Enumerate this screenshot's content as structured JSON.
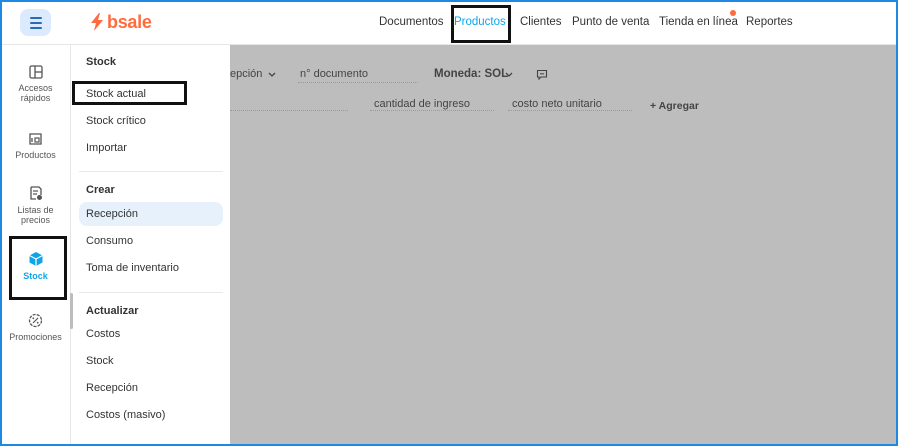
{
  "brand": {
    "name": "bsale",
    "color": "#ff6b3d",
    "accent": "#0ea5e9"
  },
  "topnav": [
    {
      "label": "Documentos",
      "active": false
    },
    {
      "label": "Productos",
      "active": true
    },
    {
      "label": "Clientes",
      "active": false
    },
    {
      "label": "Punto de venta",
      "active": false
    },
    {
      "label": "Tienda en línea",
      "active": false,
      "badge": true
    },
    {
      "label": "Reportes",
      "active": false
    }
  ],
  "rail": [
    {
      "label": "Accesos rápidos",
      "icon": "quick-access-icon"
    },
    {
      "label": "Productos",
      "icon": "products-icon"
    },
    {
      "label": "Listas de precios",
      "icon": "price-list-icon"
    },
    {
      "label": "Stock",
      "icon": "stock-box-icon",
      "active": true
    },
    {
      "label": "Promociones",
      "icon": "promotions-icon"
    }
  ],
  "panel": {
    "stock_title": "Stock",
    "stock_items": [
      "Stock actual",
      "Stock crítico",
      "Importar"
    ],
    "crear_title": "Crear",
    "crear_items": [
      "Recepción",
      "Consumo",
      "Toma de inventario"
    ],
    "actualizar_title": "Actualizar",
    "actualizar_items": [
      "Costos",
      "Stock",
      "Recepción",
      "Costos (masivo)"
    ]
  },
  "background_form": {
    "type_partial": "epción",
    "document_number_placeholder": "n° documento",
    "currency": "Moneda: SOL",
    "col_qty": "cantidad de ingreso",
    "col_cost": "costo neto unitario",
    "add_label": "+ Agregar"
  }
}
